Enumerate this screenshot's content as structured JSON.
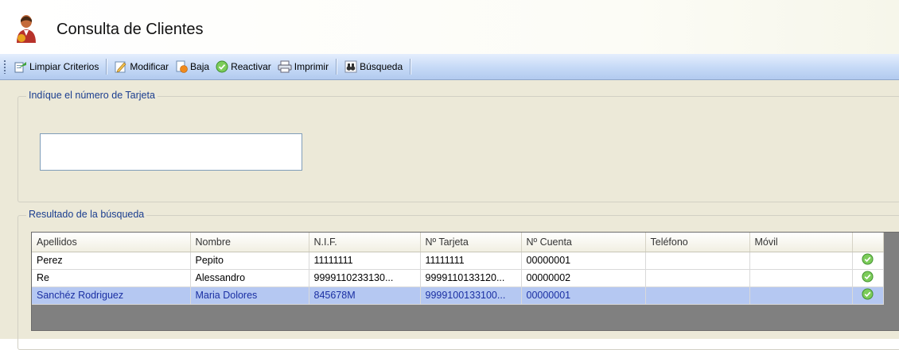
{
  "header": {
    "title": "Consulta de Clientes",
    "icon": "user-person-icon"
  },
  "toolbar": {
    "buttons": [
      {
        "label": "Limpiar Criterios",
        "icon": "clear-criteria-icon"
      },
      {
        "label": "Modificar",
        "icon": "edit-pencil-icon"
      },
      {
        "label": "Baja",
        "icon": "remove-orange-icon"
      },
      {
        "label": "Reactivar",
        "icon": "check-circle-icon"
      },
      {
        "label": "Imprimir",
        "icon": "printer-icon"
      },
      {
        "label": "Búsqueda",
        "icon": "binoculars-icon"
      }
    ]
  },
  "criteria": {
    "legend": "Indíque el número de Tarjeta",
    "card_number_value": ""
  },
  "results": {
    "legend": "Resultado de la búsqueda",
    "columns": [
      "Apellidos",
      "Nombre",
      "N.I.F.",
      "Nº Tarjeta",
      "Nº Cuenta",
      "Teléfono",
      "Móvil",
      ""
    ],
    "rows": [
      {
        "apellidos": "Perez",
        "nombre": "Pepito",
        "nif": "11111111",
        "tarjeta": "11111111",
        "cuenta": "00000001",
        "telefono": "",
        "movil": "",
        "status_icon": "active-check-icon",
        "selected": false
      },
      {
        "apellidos": "Re",
        "nombre": "Alessandro",
        "nif": "9999110233130...",
        "tarjeta": "9999110133120...",
        "cuenta": "00000002",
        "telefono": "",
        "movil": "",
        "status_icon": "active-check-icon",
        "selected": false
      },
      {
        "apellidos": "Sanchéz Rodriguez",
        "nombre": "Maria Dolores",
        "nif": "845678M",
        "tarjeta": "9999100133100...",
        "cuenta": "00000001",
        "telefono": "",
        "movil": "",
        "status_icon": "active-check-icon",
        "selected": true
      }
    ]
  },
  "colors": {
    "selected_row": "#b5c8f2",
    "selected_text": "#1a2fa3",
    "legend_text": "#1a3d8f",
    "workarea": "#ece9d8"
  }
}
